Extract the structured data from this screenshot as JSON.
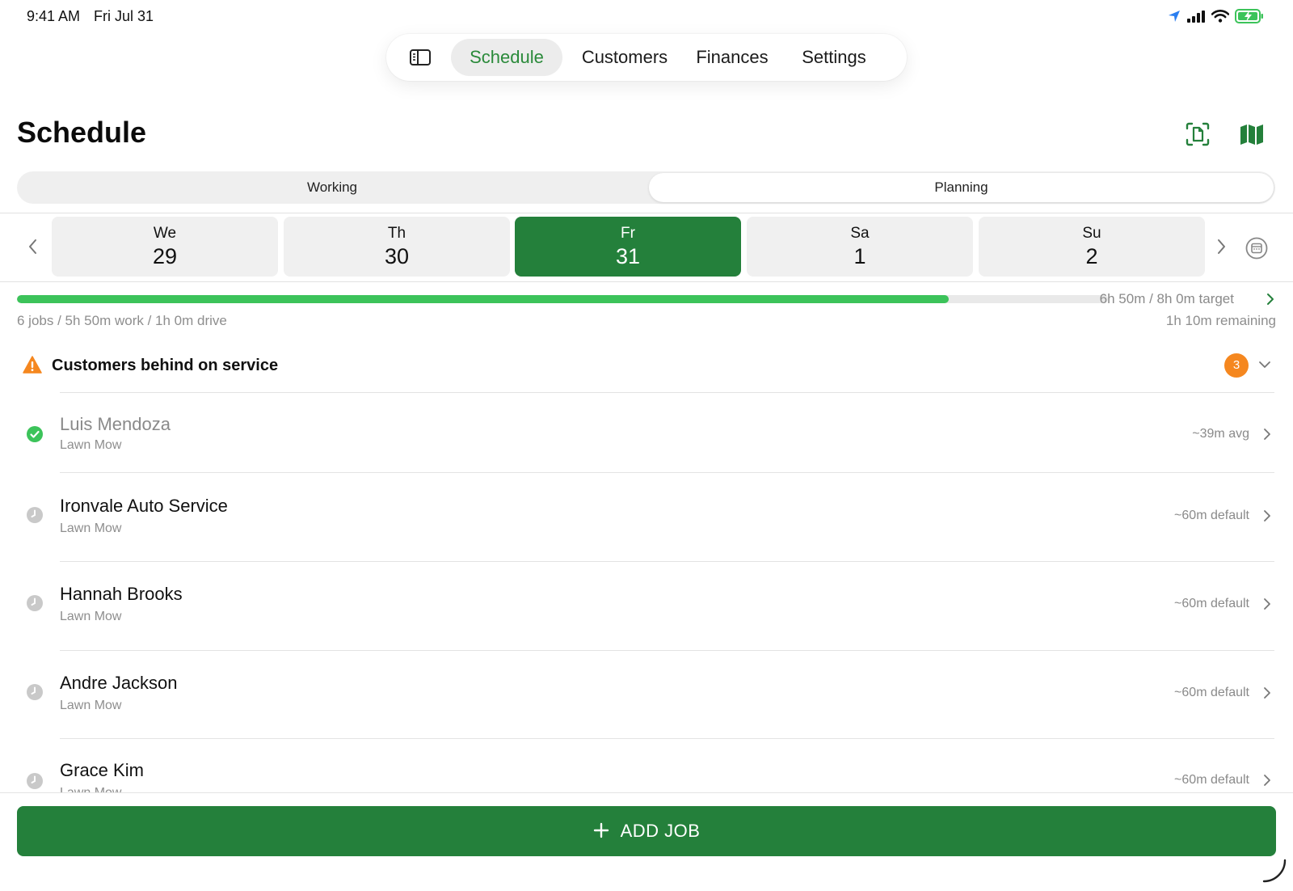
{
  "status_bar": {
    "time": "9:41 AM",
    "date": "Fri Jul 31"
  },
  "top_nav": {
    "tabs": [
      {
        "label": "Schedule",
        "active": true
      },
      {
        "label": "Customers",
        "active": false
      },
      {
        "label": "Finances",
        "active": false
      },
      {
        "label": "Settings",
        "active": false
      }
    ]
  },
  "header": {
    "title": "Schedule"
  },
  "segmented": {
    "items": [
      "Working",
      "Planning"
    ],
    "selected": "Planning"
  },
  "day_picker": {
    "days": [
      {
        "name": "We",
        "num": "29"
      },
      {
        "name": "Th",
        "num": "30"
      },
      {
        "name": "Fr",
        "num": "31",
        "selected": true
      },
      {
        "name": "Sa",
        "num": "1"
      },
      {
        "name": "Su",
        "num": "2"
      }
    ]
  },
  "progress": {
    "fraction": 0.854,
    "target_text": "6h 50m / 8h 0m target",
    "summary": "6 jobs / 5h 50m work / 1h 0m drive",
    "remaining": "1h 10m remaining"
  },
  "warning": {
    "text": "Customers behind on service",
    "count": "3"
  },
  "jobs": [
    {
      "name": "Luis Mendoza",
      "service": "Lawn Mow",
      "duration": "~39m avg",
      "status": "done"
    },
    {
      "name": "Ironvale Auto Service",
      "service": "Lawn Mow",
      "duration": "~60m default",
      "status": "pending"
    },
    {
      "name": "Hannah Brooks",
      "service": "Lawn Mow",
      "duration": "~60m default",
      "status": "pending"
    },
    {
      "name": "Andre Jackson",
      "service": "Lawn Mow",
      "duration": "~60m default",
      "status": "pending"
    },
    {
      "name": "Grace Kim",
      "service": "Lawn Mow",
      "duration": "~60m default",
      "status": "pending"
    }
  ],
  "add_job": {
    "label": "ADD JOB"
  },
  "colors": {
    "accent": "#24803b",
    "progress": "#3cc35a",
    "warning": "#f5871f",
    "active_tab_text": "#2a8a3a"
  }
}
